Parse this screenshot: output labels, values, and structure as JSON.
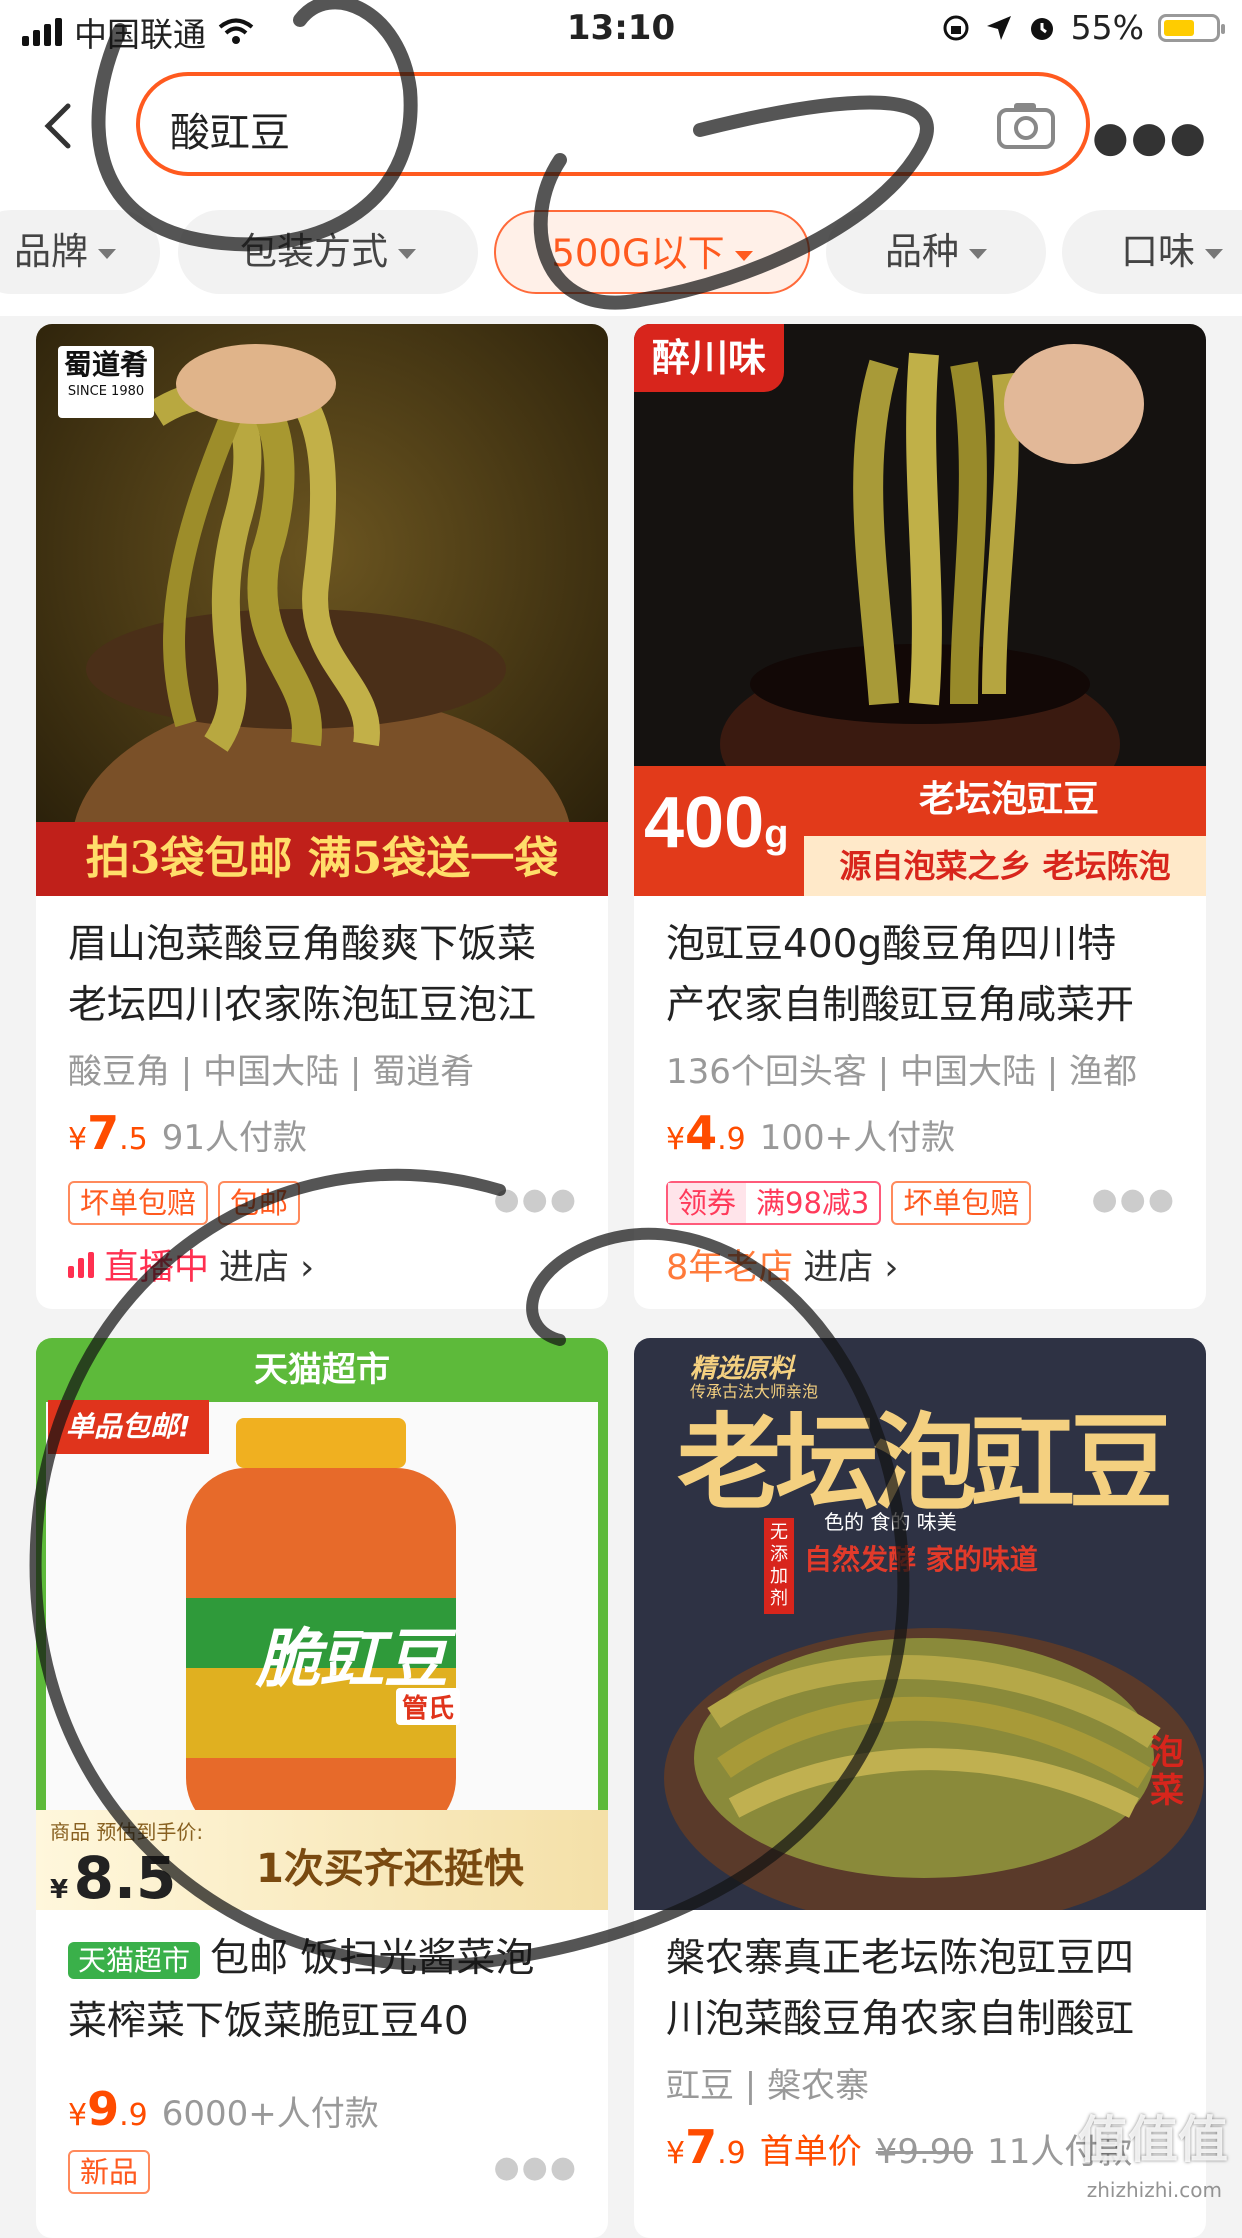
{
  "status": {
    "carrier": "中国联通",
    "time": "13:10",
    "battery": "55%"
  },
  "search": {
    "query": "酸豇豆"
  },
  "filters": [
    {
      "label": "品牌",
      "active": false
    },
    {
      "label": "包装方式",
      "active": false
    },
    {
      "label": "500G以下",
      "active": true
    },
    {
      "label": "品种",
      "active": false
    },
    {
      "label": "口味",
      "active": false
    }
  ],
  "products": [
    {
      "brand_logo": "蜀道肴",
      "brand_since": "SINCE 1980",
      "banner": "拍3袋包邮 满5袋送一袋",
      "title_l1": "眉山泡菜酸豆角酸爽下饭菜",
      "title_l2": "老坛四川农家陈泡缸豆泡江",
      "meta": "酸豆角 | 中国大陆 | 蜀逍肴",
      "price_yen": "¥",
      "price_int": "7",
      "price_dec": ".5",
      "payers": "91人付款",
      "tags": [
        "坏单包赔",
        "包邮"
      ],
      "shop_status": "直播中",
      "shop_link": "进店 ›"
    },
    {
      "brand_logo": "醉川味",
      "banner_weight": "400",
      "banner_unit": "g",
      "banner_top": "老坛泡豇豆",
      "banner_bottom": "源自泡菜之乡 老坛陈泡",
      "title_l1": "泡豇豆400g酸豆角四川特",
      "title_l2": "产农家自制酸豇豆角咸菜开",
      "meta": "136个回头客 | 中国大陆 | 渔都",
      "price_yen": "¥",
      "price_int": "4",
      "price_dec": ".9",
      "payers": "100+人付款",
      "coupon_a": "领券",
      "coupon_b": "满98减3",
      "tag": "坏单包赔",
      "shop_status": "8年老店",
      "shop_link": "进店 ›"
    },
    {
      "top_banner": "天猫超市",
      "ribbon": "单品包邮!",
      "jar_label": "脆豇豆",
      "jar_brand": "管氏",
      "est_label": "商品 预估到手价:",
      "est_yen": "¥",
      "est_price": "8.5",
      "bottom_slogan": "1次买齐还挺快",
      "badge": "天猫超市",
      "title_l1": "包邮 饭扫光酱菜泡",
      "title_l2": "菜榨菜下饭菜脆豇豆40",
      "price_yen": "¥",
      "price_int": "9",
      "price_dec": ".9",
      "payers": "6000+人付款",
      "tag": "新品"
    },
    {
      "poster_small": "精选原料",
      "poster_small2": "传承古法大师亲泡",
      "poster_title": "老坛泡豇豆",
      "poster_sub": "色的 食的 味美",
      "poster_side": "无添加剂",
      "poster_slogan": "自然发酵 家的味道",
      "poster_badge": "泡菜",
      "title_l1": "槃农寨真正老坛陈泡豇豆四",
      "title_l2": "川泡菜酸豆角农家自制酸豇",
      "meta": "豇豆 | 槃农寨",
      "price_yen": "¥",
      "price_int": "7",
      "price_dec": ".9",
      "first_order": "首单价",
      "orig_price": "¥9.90",
      "payers": "11人付款"
    }
  ],
  "watermark": {
    "main": "值值值",
    "sub": "zhizhizhi.com"
  }
}
